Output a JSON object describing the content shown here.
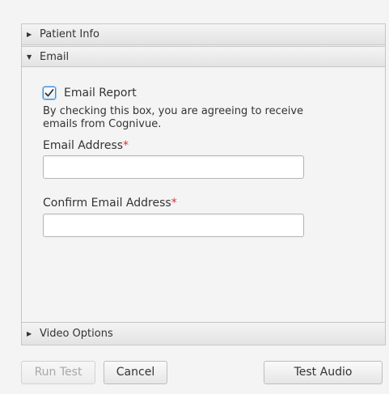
{
  "accordion": {
    "patient_info": {
      "label": "Patient Info",
      "icon": "triangle-right-icon",
      "expanded": false
    },
    "email": {
      "label": "Email",
      "icon": "triangle-down-icon",
      "expanded": true
    },
    "video_options": {
      "label": "Video Options",
      "icon": "triangle-right-icon",
      "expanded": false
    }
  },
  "email_section": {
    "checkbox_label": "Email Report",
    "checkbox_checked": true,
    "agreement_text": "By checking this box, you are agreeing to receive emails from Cognivue.",
    "email_label": "Email Address",
    "email_value": "",
    "confirm_label": "Confirm Email Address",
    "confirm_value": "",
    "required_marker": "*"
  },
  "buttons": {
    "run_test": "Run Test",
    "cancel": "Cancel",
    "test_audio": "Test Audio"
  },
  "colors": {
    "accent": "#3b8fd6",
    "required": "#e03030",
    "disabled_text": "#a8a8a8"
  }
}
